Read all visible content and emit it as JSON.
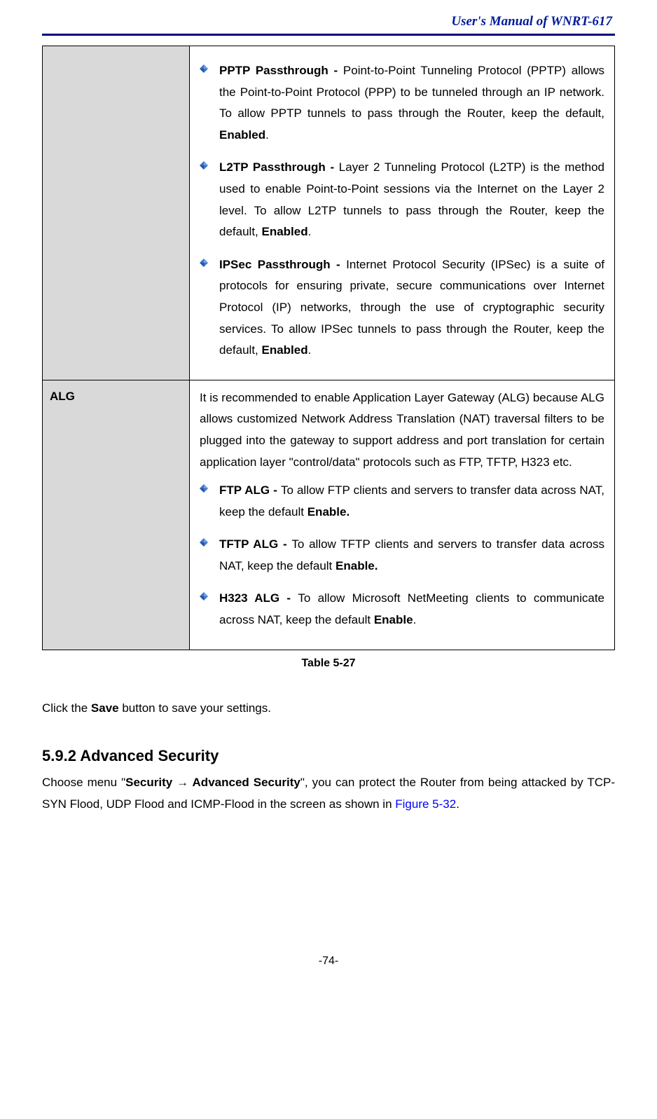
{
  "header": {
    "title": "User's Manual of WNRT-617"
  },
  "table": {
    "row1": {
      "label": "",
      "items": [
        {
          "title": "PPTP Passthrough - ",
          "desc_pre": "Point-to-Point Tunneling Protocol (PPTP) allows the Point-to-Point Protocol (PPP) to be tunneled through an IP network. To allow PPTP tunnels to pass through the Router, keep the default, ",
          "bold": "Enabled",
          "desc_post": "."
        },
        {
          "title": "L2TP Passthrough - ",
          "desc_pre": "Layer 2 Tunneling Protocol (L2TP) is the method used to enable Point-to-Point sessions via the Internet on the Layer 2 level. To allow L2TP tunnels to pass through the Router, keep the default, ",
          "bold": "Enabled",
          "desc_post": "."
        },
        {
          "title": "IPSec Passthrough - ",
          "desc_pre": "Internet Protocol Security (IPSec) is a suite of protocols for ensuring private, secure communications over Internet Protocol (IP) networks, through the use of cryptographic security services. To allow IPSec tunnels to pass through the Router, keep the default, ",
          "bold": "Enabled",
          "desc_post": "."
        }
      ]
    },
    "row2": {
      "label": "ALG",
      "intro": "It is recommended to enable Application Layer Gateway (ALG) because ALG allows customized Network Address Translation (NAT) traversal filters to be plugged into the gateway to support address and port translation for certain application layer \"control/data\" protocols such as FTP, TFTP, H323 etc.",
      "items": [
        {
          "title": "FTP ALG - ",
          "desc_pre": "To allow FTP clients and servers to transfer data across NAT, keep the default ",
          "bold": "Enable.",
          "desc_post": ""
        },
        {
          "title": "TFTP ALG - ",
          "desc_pre": "To allow TFTP clients and servers to transfer data across NAT, keep the default ",
          "bold": "Enable.",
          "desc_post": ""
        },
        {
          "title": "H323 ALG - ",
          "desc_pre": "To allow Microsoft NetMeeting clients to communicate across NAT, keep the default ",
          "bold": "Enable",
          "desc_post": "."
        }
      ]
    },
    "caption": "Table 5-27"
  },
  "save": {
    "pre": "Click the ",
    "bold": "Save",
    "post": " button to save your settings."
  },
  "section": {
    "heading": "5.9.2   Advanced Security"
  },
  "nav": {
    "pre": "Choose menu \"",
    "b1": "Security",
    "arrow": "  →  ",
    "b2": "Advanced Security",
    "mid": "\", you can protect the Router from being attacked by TCP-SYN Flood, UDP Flood and ICMP-Flood in the screen as shown in ",
    "link": "Figure 5-32",
    "post": "."
  },
  "footer": {
    "page": "-74-"
  }
}
